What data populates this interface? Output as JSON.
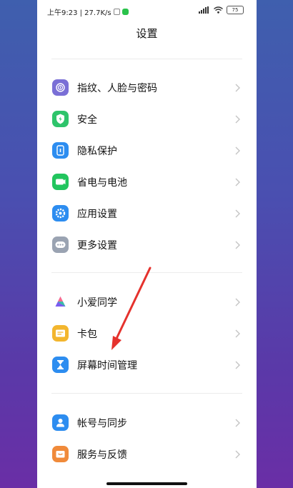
{
  "status_bar": {
    "time_speed": "上午9:23 | 27.7K/s",
    "battery": "75"
  },
  "header": {
    "title": "设置"
  },
  "groups": [
    {
      "items": [
        {
          "label": "指纹、人脸与密码",
          "icon": "fingerprint-icon",
          "color": "#7a6fd6"
        },
        {
          "label": "安全",
          "icon": "shield-bolt-icon",
          "color": "#2ec46b"
        },
        {
          "label": "隐私保护",
          "icon": "privacy-icon",
          "color": "#2d8df0"
        },
        {
          "label": "省电与电池",
          "icon": "battery-icon",
          "color": "#22c55e"
        },
        {
          "label": "应用设置",
          "icon": "gear-icon",
          "color": "#2d8df0"
        },
        {
          "label": "更多设置",
          "icon": "more-dots-icon",
          "color": "#9aa3b2"
        }
      ]
    },
    {
      "items": [
        {
          "label": "小爱同学",
          "icon": "xiaoai-icon",
          "color": "#7a5cf0"
        },
        {
          "label": "卡包",
          "icon": "card-wallet-icon",
          "color": "#f3b62e"
        },
        {
          "label": "屏幕时间管理",
          "icon": "hourglass-icon",
          "color": "#2d8df0"
        }
      ]
    },
    {
      "items": [
        {
          "label": "帐号与同步",
          "icon": "account-icon",
          "color": "#2d8df0"
        },
        {
          "label": "服务与反馈",
          "icon": "service-feedback-icon",
          "color": "#f08a3a"
        }
      ]
    }
  ]
}
